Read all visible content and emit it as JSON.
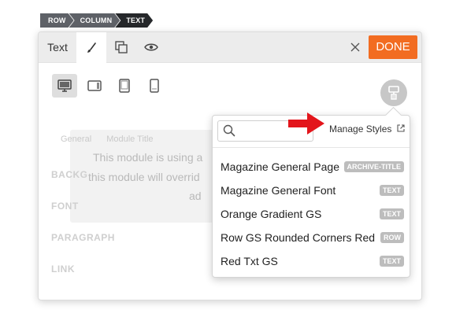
{
  "breadcrumb": [
    "ROW",
    "COLUMN",
    "TEXT"
  ],
  "panel": {
    "title_tab": "Text",
    "done_label": "DONE",
    "accent_color": "#f26c21"
  },
  "devices": [
    "desktop-icon",
    "tablet-landscape-icon",
    "tablet-icon",
    "phone-icon"
  ],
  "notice": {
    "tabs": [
      "General",
      "Module Title"
    ],
    "line1": "This module is using a",
    "line2": "this module will overrid",
    "line3": "ad"
  },
  "side_labels": [
    "BACKG",
    "FONT",
    "PARAGRAPH",
    "LINK"
  ],
  "dropdown": {
    "search_placeholder": "",
    "manage_label": "Manage Styles",
    "items": [
      {
        "label": "Magazine General Page",
        "badge": "ARCHIVE-TITLE"
      },
      {
        "label": "Magazine General Font",
        "badge": "TEXT"
      },
      {
        "label": "Orange Gradient GS",
        "badge": "TEXT"
      },
      {
        "label": "Row GS Rounded Corners Red",
        "badge": "ROW"
      },
      {
        "label": "Red Txt GS",
        "badge": "TEXT"
      }
    ]
  }
}
